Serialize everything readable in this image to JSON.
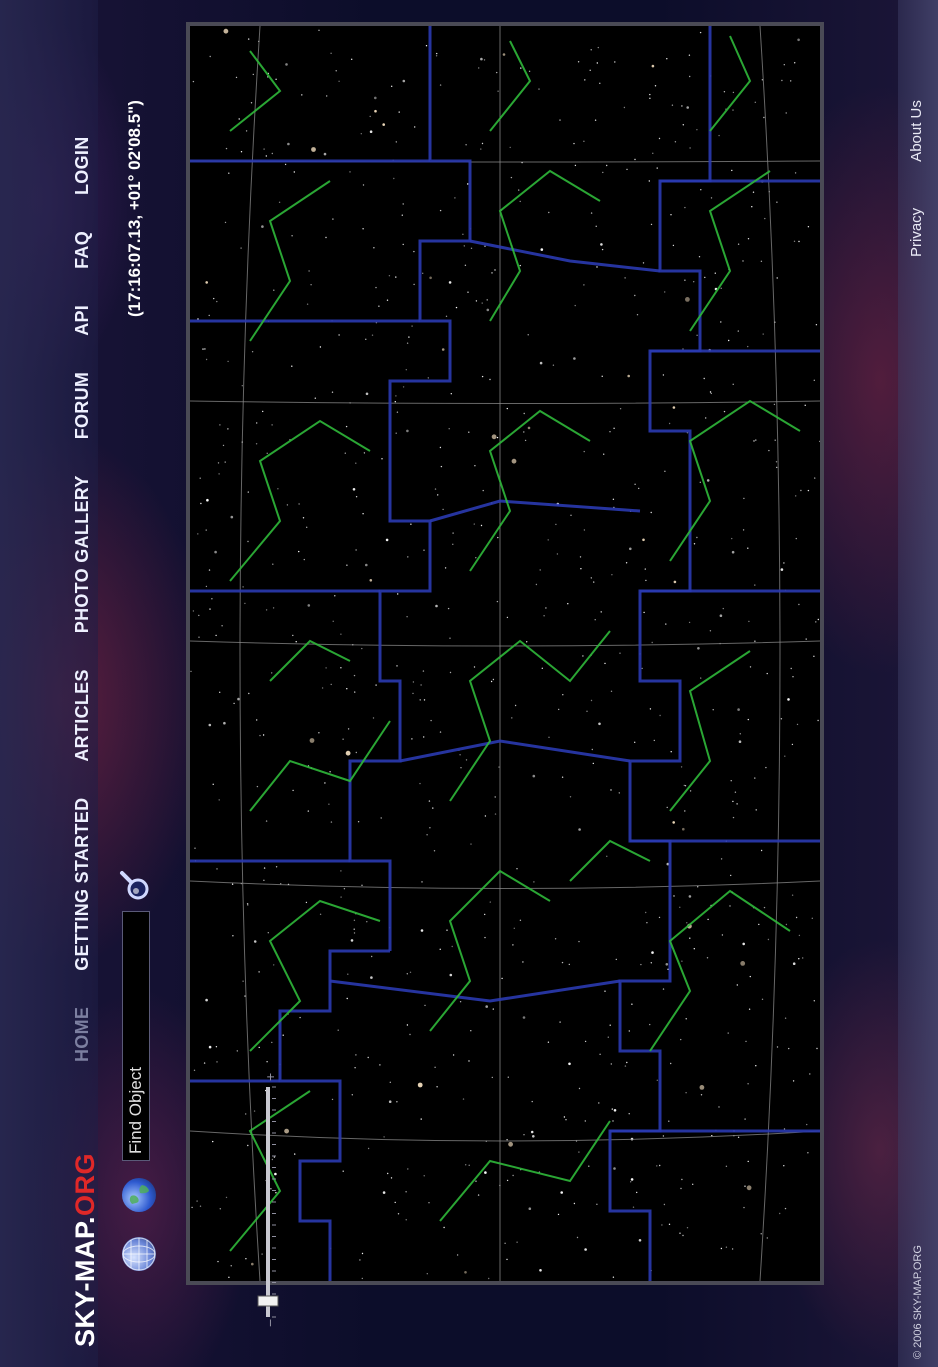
{
  "logo": {
    "main": "SKY-MAP.",
    "accent": "ORG"
  },
  "nav": {
    "items": [
      {
        "label": "HOME",
        "active": true
      },
      {
        "label": "GETTING STARTED",
        "active": false
      },
      {
        "label": "ARTICLES",
        "active": false
      },
      {
        "label": "PHOTO GALLERY",
        "active": false
      },
      {
        "label": "FORUM",
        "active": false
      },
      {
        "label": "API",
        "active": false
      },
      {
        "label": "FAQ",
        "active": false
      },
      {
        "label": "LOGIN",
        "active": false
      }
    ]
  },
  "search": {
    "placeholder": "Find Object"
  },
  "coordinates": "(17:16:07.13, +01° 02'08.5\")",
  "zoom": {
    "level": 0.05
  },
  "footer": {
    "copyright": "© 2006 SKY-MAP.ORG",
    "links": [
      "Privacy",
      "About Us"
    ]
  },
  "colors": {
    "constellation_lines": "#2fb83a",
    "boundaries": "#2a3ab0",
    "grid": "#8a8a8a",
    "accent": "#e02828"
  },
  "icons": {
    "globe_1": "wireframe-globe-icon",
    "globe_2": "earth-globe-icon",
    "search": "magnifier-icon"
  }
}
